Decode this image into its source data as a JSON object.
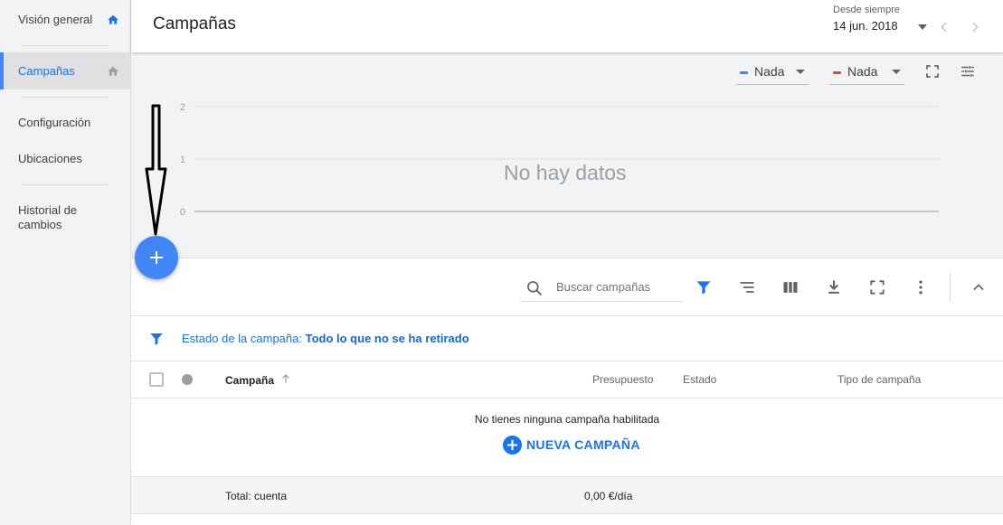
{
  "sidebar": {
    "items": [
      {
        "label": "Visión general",
        "icon": "home-icon"
      },
      {
        "label": "Campañas",
        "icon": "home-icon",
        "active": true
      },
      {
        "label": "Configuración"
      },
      {
        "label": "Ubicaciones"
      },
      {
        "label": "Historial de cambios",
        "line1": "Historial de",
        "line2": "cambios"
      }
    ]
  },
  "header": {
    "title": "Campañas",
    "date_range": {
      "label": "Desde siempre",
      "value": "14 jun. 2018"
    }
  },
  "chart": {
    "metrics": [
      {
        "label": "Nada",
        "color": "#4285f4"
      },
      {
        "label": "Nada",
        "color": "#db4437"
      }
    ],
    "no_data_text": "No hay datos"
  },
  "chart_data": {
    "type": "line",
    "series": [],
    "yticks": [
      "2",
      "1",
      "0"
    ],
    "ylim": [
      0,
      2
    ],
    "grid": true
  },
  "table": {
    "search_placeholder": "Buscar campañas",
    "filter": {
      "label": "Estado de la campaña:",
      "value": "Todo lo que no se ha retirado"
    },
    "columns": {
      "campaign": "Campaña",
      "budget": "Presupuesto",
      "status": "Estado",
      "type": "Tipo de campaña"
    },
    "empty_message": "No tienes ninguna campaña habilitada",
    "new_campaign_label": "NUEVA CAMPAÑA",
    "total": {
      "label": "Total: cuenta",
      "budget": "0,00 €/día"
    }
  },
  "colors": {
    "accent": "#4285f4",
    "link": "#1a73e8",
    "series1": "#4285f4",
    "series2": "#db4437"
  }
}
